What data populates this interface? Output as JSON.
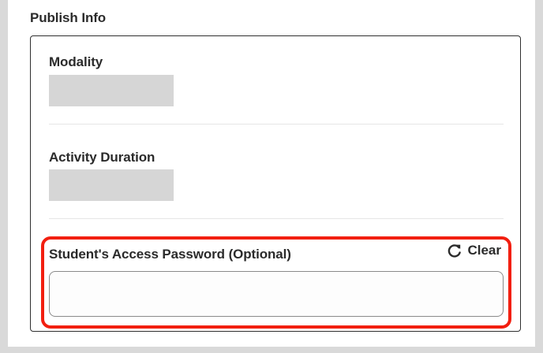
{
  "publish_info": {
    "title": "Publish Info",
    "fields": {
      "modality": {
        "label": "Modality",
        "value": ""
      },
      "activity_duration": {
        "label": "Activity Duration",
        "value": ""
      },
      "access_password": {
        "label": "Student's Access Password (Optional)",
        "value": "",
        "clear_label": "Clear",
        "clear_icon": "refresh-icon"
      }
    }
  },
  "colors": {
    "highlight": "#f21f10",
    "placeholder_fill": "#d6d6d6",
    "text": "#2b2b2b"
  }
}
